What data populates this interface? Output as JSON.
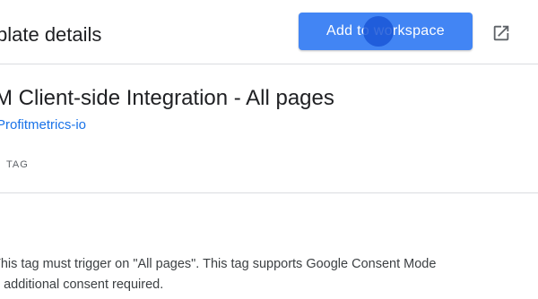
{
  "header": {
    "title": "plate details",
    "add_button_label": "Add to workspace",
    "open_icon": "open-in-new-icon"
  },
  "template": {
    "name": "M Client-side Integration - All pages",
    "publisher": "Profitmetrics-io",
    "type": "TAG",
    "description_lines": [
      "This tag must trigger on \"All pages\". This tag supports Google Consent Mode",
      "o additional consent required."
    ]
  },
  "colors": {
    "accent": "#4285f4",
    "link": "#1a73e8",
    "divider": "#dadce0"
  }
}
